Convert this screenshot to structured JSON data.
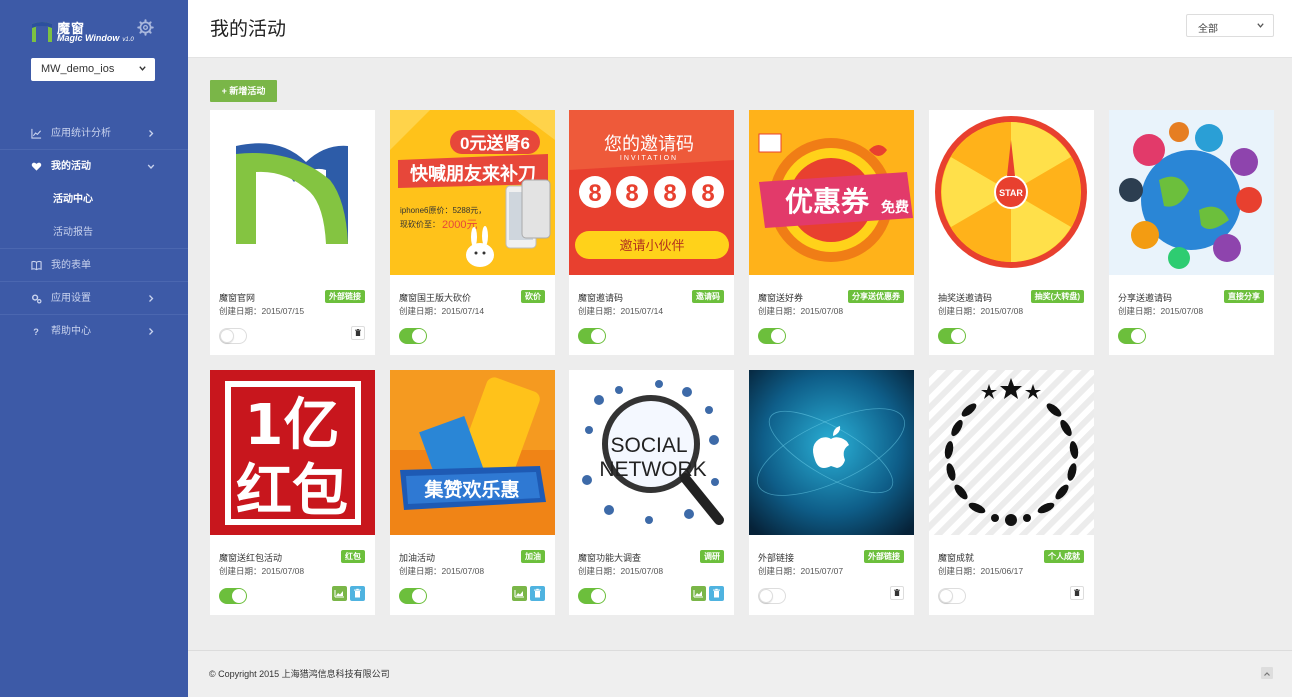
{
  "brand": {
    "logo_cn": "魔窗",
    "logo_en": "Magic Window",
    "version": "v1.0"
  },
  "app_select": {
    "value": "MW_demo_ios"
  },
  "nav": {
    "stats": "应用统计分析",
    "activities": "我的活动",
    "activity_center": "活动中心",
    "activity_report": "活动报告",
    "forms": "我的表单",
    "settings": "应用设置",
    "help": "帮助中心"
  },
  "header": {
    "title": "我的活动",
    "filter": "全部"
  },
  "add_button": "+ 新增活动",
  "cards": [
    {
      "name": "魔窗官网",
      "date": "创建日期：2015/07/15",
      "tag": "外部链接",
      "enabled": false,
      "thumb": "magicwindow-logo"
    },
    {
      "name": "魔窗国王版大砍价",
      "date": "创建日期：2015/07/14",
      "tag": "砍价",
      "enabled": true,
      "thumb": "bargain-iphone6"
    },
    {
      "name": "魔窗邀请码",
      "date": "创建日期：2015/07/14",
      "tag": "邀请码",
      "enabled": true,
      "thumb": "invitation-code"
    },
    {
      "name": "魔窗送好券",
      "date": "创建日期：2015/07/08",
      "tag": "分享送优惠券",
      "enabled": true,
      "thumb": "coupon"
    },
    {
      "name": "抽奖送邀请码",
      "date": "创建日期：2015/07/08",
      "tag": "抽奖(大转盘)",
      "enabled": true,
      "thumb": "lucky-wheel"
    },
    {
      "name": "分享送邀请码",
      "date": "创建日期：2015/07/08",
      "tag": "直接分享",
      "enabled": true,
      "thumb": "social-globe"
    },
    {
      "name": "魔窗送红包活动",
      "date": "创建日期：2015/07/08",
      "tag": "红包",
      "enabled": true,
      "thumb": "red-envelope"
    },
    {
      "name": "加油活动",
      "date": "创建日期：2015/07/08",
      "tag": "加油",
      "enabled": true,
      "thumb": "cheer-ticket"
    },
    {
      "name": "魔窗功能大调查",
      "date": "创建日期：2015/07/08",
      "tag": "调研",
      "enabled": true,
      "thumb": "social-network"
    },
    {
      "name": "外部链接",
      "date": "创建日期：2015/07/07",
      "tag": "外部链接",
      "enabled": false,
      "thumb": "apple-blue"
    },
    {
      "name": "魔窗成就",
      "date": "创建日期：2015/06/17",
      "tag": "个人成就",
      "enabled": false,
      "thumb": "laurel-wreath"
    }
  ],
  "thumb_text": {
    "bargain_title": "0元送肾6",
    "bargain_sub": "快喊朋友来补刀",
    "bargain_price1": "iphone6原价：5288元，",
    "bargain_price2": "现砍价至：",
    "bargain_price3": "2000元",
    "invite_title": "您的邀请码",
    "invite_sub": "INVITATION",
    "invite_digits": [
      "8",
      "8",
      "8",
      "8"
    ],
    "invite_btn": "邀请小伙伴",
    "coupon_text": "优惠券",
    "coupon_free": "免费",
    "wheel_center": "STAR",
    "redpack_1": "1亿",
    "redpack_2": "红包",
    "cheer_text": "集赞欢乐惠",
    "social_1": "SOCIAL",
    "social_2": "NETWORK"
  },
  "footer": {
    "copyright": "© Copyright 2015 上海猎鸿信息科技有限公司"
  },
  "colors": {
    "sidebar": "#3d5aa7",
    "accent_green": "#6cbf3c",
    "add_button": "#7ab648",
    "action_blue": "#4fb3e0"
  }
}
